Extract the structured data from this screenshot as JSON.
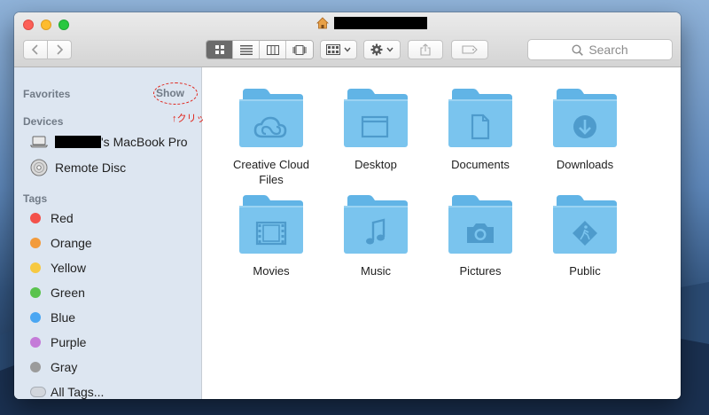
{
  "window": {
    "title_redacted": true
  },
  "toolbar": {
    "search_placeholder": "Search"
  },
  "sidebar": {
    "favorites": {
      "label": "Favorites",
      "show_label": "Show",
      "annotation": "↑クリック"
    },
    "devices": {
      "label": "Devices",
      "items": [
        {
          "label": "'s MacBook Pro",
          "icon": "laptop-icon"
        },
        {
          "label": "Remote Disc",
          "icon": "disc-icon"
        }
      ]
    },
    "tags": {
      "label": "Tags",
      "items": [
        {
          "label": "Red",
          "color": "#f3514b"
        },
        {
          "label": "Orange",
          "color": "#f29b3c"
        },
        {
          "label": "Yellow",
          "color": "#f6c942"
        },
        {
          "label": "Green",
          "color": "#5ac34e"
        },
        {
          "label": "Blue",
          "color": "#4aa6f2"
        },
        {
          "label": "Purple",
          "color": "#c47bd8"
        },
        {
          "label": "Gray",
          "color": "#9b9b9b"
        },
        {
          "label": "All Tags...",
          "color": "#d2d6dc"
        }
      ]
    }
  },
  "folders": [
    {
      "label": "Creative Cloud Files",
      "icon": "creative-cloud-icon"
    },
    {
      "label": "Desktop",
      "icon": "desktop-icon"
    },
    {
      "label": "Documents",
      "icon": "document-icon"
    },
    {
      "label": "Downloads",
      "icon": "download-icon"
    },
    {
      "label": "Movies",
      "icon": "film-icon"
    },
    {
      "label": "Music",
      "icon": "music-note-icon"
    },
    {
      "label": "Pictures",
      "icon": "camera-icon"
    },
    {
      "label": "Public",
      "icon": "public-sign-icon"
    }
  ],
  "colors": {
    "folder_body": "#7ac4ee",
    "folder_tab": "#61b4e6",
    "folder_glyph": "#4e9bcc"
  }
}
